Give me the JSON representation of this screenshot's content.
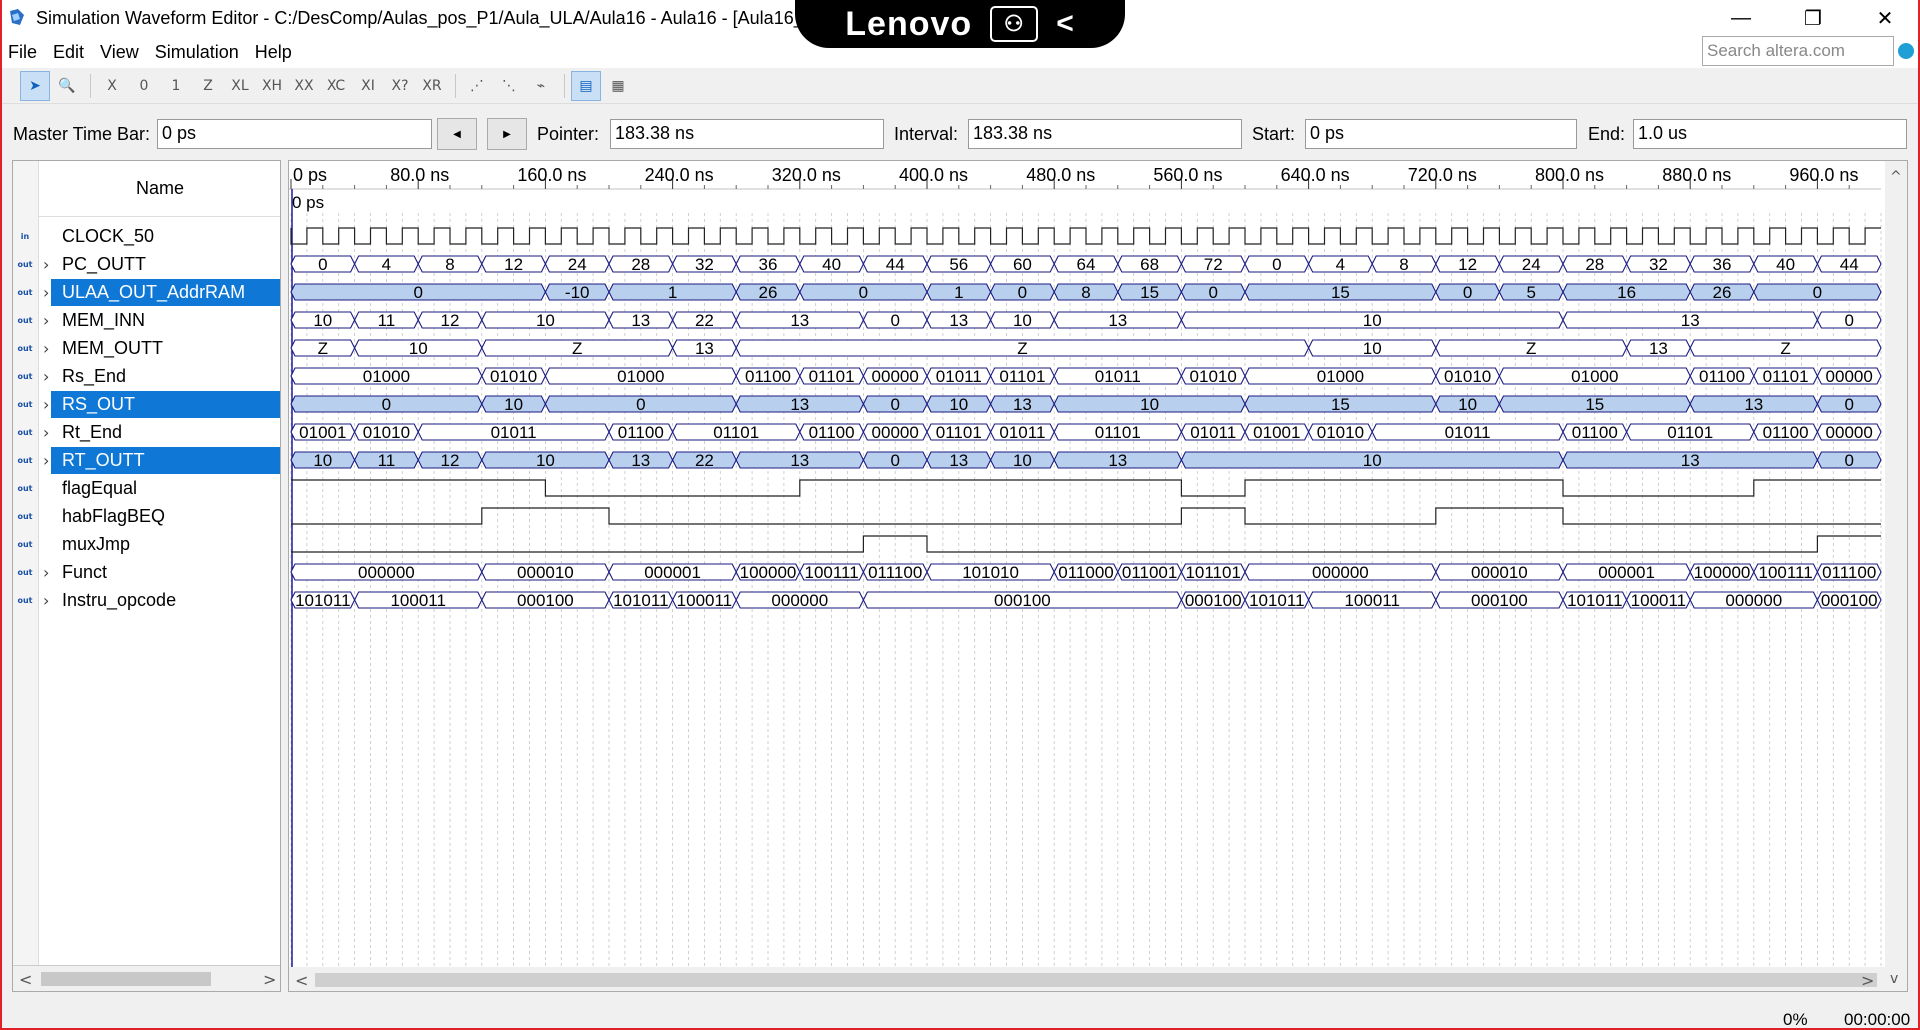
{
  "window": {
    "title": "Simulation Waveform Editor - C:/DesComp/Aulas_pos_P1/Aula_ULA/Aula16 - Aula16 - [Aula16_2",
    "minimize_glyph": "—",
    "restore_glyph": "❐",
    "close_glyph": "✕"
  },
  "overlay": {
    "brand": "Lenovo",
    "box_glyph": "⚇",
    "back_glyph": "<"
  },
  "menu": {
    "items": [
      "File",
      "Edit",
      "View",
      "Simulation",
      "Help"
    ]
  },
  "search": {
    "placeholder": "Search altera.com"
  },
  "toolbar": {
    "tools": [
      {
        "icon": "pointer-icon",
        "glyph": "➤",
        "active": true
      },
      {
        "icon": "zoom-icon",
        "glyph": "🔍",
        "active": false
      },
      {
        "icon": "sep"
      },
      {
        "icon": "force-unknown-icon",
        "glyph": "X"
      },
      {
        "icon": "force-low-icon",
        "glyph": "0"
      },
      {
        "icon": "force-high-icon",
        "glyph": "1"
      },
      {
        "icon": "high-impedance-icon",
        "glyph": "Z"
      },
      {
        "icon": "weak-low-icon",
        "glyph": "XL"
      },
      {
        "icon": "weak-high-icon",
        "glyph": "XH"
      },
      {
        "icon": "dont-care-icon",
        "glyph": "XX"
      },
      {
        "icon": "invert-icon",
        "glyph": "XC"
      },
      {
        "icon": "count-value-icon",
        "glyph": "XI"
      },
      {
        "icon": "arbitrary-value-icon",
        "glyph": "X?"
      },
      {
        "icon": "random-value-icon",
        "glyph": "XR"
      },
      {
        "icon": "sep"
      },
      {
        "icon": "snap-grid-icon",
        "glyph": "⋰"
      },
      {
        "icon": "grid-icon",
        "glyph": "⋱"
      },
      {
        "icon": "overwrite-icon",
        "glyph": "⌁"
      },
      {
        "icon": "sep"
      },
      {
        "icon": "waveform-view-icon",
        "glyph": "▤",
        "active": true
      },
      {
        "icon": "grid-view-icon",
        "glyph": "▦"
      }
    ]
  },
  "timebar": {
    "master_label": "Master Time Bar:",
    "master_value": "0 ps",
    "prev_glyph": "◀",
    "next_glyph": "▶",
    "pointer_label": "Pointer:",
    "pointer_value": "183.38 ns",
    "interval_label": "Interval:",
    "interval_value": "183.38 ns",
    "start_label": "Start:",
    "start_value": "0 ps",
    "end_label": "End:",
    "end_value": "1.0 us"
  },
  "names_header": "Name",
  "time_scale": {
    "ticks": [
      "0 ps",
      "80.0 ns",
      "160.0 ns",
      "240.0 ns",
      "320.0 ns",
      "400.0 ns",
      "480.0 ns",
      "560.0 ns",
      "640.0 ns",
      "720.0 ns",
      "800.0 ns",
      "880.0 ns",
      "960.0 ns"
    ],
    "marker_label": "0 ps"
  },
  "signals": [
    {
      "name": "CLOCK_50",
      "dir": "in",
      "kind": "clock",
      "expand": false,
      "selected": false
    },
    {
      "name": "PC_OUTT",
      "dir": "out",
      "kind": "bus",
      "expand": true,
      "selected": false,
      "segments": [
        [
          0,
          "0"
        ],
        [
          40,
          "4"
        ],
        [
          80,
          "8"
        ],
        [
          120,
          "12"
        ],
        [
          160,
          "24"
        ],
        [
          200,
          "28"
        ],
        [
          240,
          "32"
        ],
        [
          280,
          "36"
        ],
        [
          320,
          "40"
        ],
        [
          360,
          "44"
        ],
        [
          400,
          "56"
        ],
        [
          440,
          "60"
        ],
        [
          480,
          "64"
        ],
        [
          520,
          "68"
        ],
        [
          560,
          "72"
        ],
        [
          600,
          "0"
        ],
        [
          640,
          "4"
        ],
        [
          680,
          "8"
        ],
        [
          720,
          "12"
        ],
        [
          760,
          "24"
        ],
        [
          800,
          "28"
        ],
        [
          840,
          "32"
        ],
        [
          880,
          "36"
        ],
        [
          920,
          "40"
        ],
        [
          960,
          "44"
        ]
      ]
    },
    {
      "name": "ULAA_OUT_AddrRAM",
      "dir": "out",
      "kind": "bus",
      "expand": true,
      "selected": true,
      "segments": [
        [
          0,
          "0"
        ],
        [
          160,
          "-10"
        ],
        [
          200,
          "1"
        ],
        [
          280,
          "26"
        ],
        [
          320,
          "0"
        ],
        [
          400,
          "1"
        ],
        [
          440,
          "0"
        ],
        [
          480,
          "8"
        ],
        [
          520,
          "15"
        ],
        [
          560,
          "0"
        ],
        [
          600,
          "15"
        ],
        [
          720,
          "0"
        ],
        [
          760,
          "5"
        ],
        [
          800,
          "16"
        ],
        [
          880,
          "26"
        ],
        [
          920,
          "0"
        ]
      ]
    },
    {
      "name": "MEM_INN",
      "dir": "out",
      "kind": "bus",
      "expand": true,
      "selected": false,
      "segments": [
        [
          0,
          "10"
        ],
        [
          40,
          "11"
        ],
        [
          80,
          "12"
        ],
        [
          120,
          "10"
        ],
        [
          200,
          "13"
        ],
        [
          240,
          "22"
        ],
        [
          280,
          "13"
        ],
        [
          360,
          "0"
        ],
        [
          400,
          "13"
        ],
        [
          440,
          "10"
        ],
        [
          480,
          "13"
        ],
        [
          560,
          "10"
        ],
        [
          800,
          "13"
        ],
        [
          960,
          "0"
        ]
      ]
    },
    {
      "name": "MEM_OUTT",
      "dir": "out",
      "kind": "bus",
      "expand": true,
      "selected": false,
      "segments": [
        [
          0,
          "Z"
        ],
        [
          40,
          "10"
        ],
        [
          120,
          "Z"
        ],
        [
          240,
          "13"
        ],
        [
          280,
          "Z"
        ],
        [
          640,
          "10"
        ],
        [
          720,
          "Z"
        ],
        [
          840,
          "13"
        ],
        [
          880,
          "Z"
        ]
      ]
    },
    {
      "name": "Rs_End",
      "dir": "out",
      "kind": "bus",
      "expand": true,
      "selected": false,
      "segments": [
        [
          0,
          "01000"
        ],
        [
          120,
          "01010"
        ],
        [
          160,
          "01000"
        ],
        [
          280,
          "01100"
        ],
        [
          320,
          "01101"
        ],
        [
          360,
          "00000"
        ],
        [
          400,
          "01011"
        ],
        [
          440,
          "01101"
        ],
        [
          480,
          "01011"
        ],
        [
          560,
          "01010"
        ],
        [
          600,
          "01000"
        ],
        [
          720,
          "01010"
        ],
        [
          760,
          "01000"
        ],
        [
          880,
          "01100"
        ],
        [
          920,
          "01101"
        ],
        [
          960,
          "00000"
        ]
      ]
    },
    {
      "name": "RS_OUT",
      "dir": "out",
      "kind": "bus",
      "expand": true,
      "selected": true,
      "segments": [
        [
          0,
          "0"
        ],
        [
          120,
          "10"
        ],
        [
          160,
          "0"
        ],
        [
          280,
          "13"
        ],
        [
          360,
          "0"
        ],
        [
          400,
          "10"
        ],
        [
          440,
          "13"
        ],
        [
          480,
          "10"
        ],
        [
          600,
          "15"
        ],
        [
          720,
          "10"
        ],
        [
          760,
          "15"
        ],
        [
          880,
          "13"
        ],
        [
          960,
          "0"
        ]
      ]
    },
    {
      "name": "Rt_End",
      "dir": "out",
      "kind": "bus",
      "expand": true,
      "selected": false,
      "segments": [
        [
          0,
          "01001"
        ],
        [
          40,
          "01010"
        ],
        [
          80,
          "01011"
        ],
        [
          200,
          "01100"
        ],
        [
          240,
          "01101"
        ],
        [
          320,
          "01100"
        ],
        [
          360,
          "00000"
        ],
        [
          400,
          "01101"
        ],
        [
          440,
          "01011"
        ],
        [
          480,
          "01101"
        ],
        [
          560,
          "01011"
        ],
        [
          600,
          "01001"
        ],
        [
          640,
          "01010"
        ],
        [
          680,
          "01011"
        ],
        [
          800,
          "01100"
        ],
        [
          840,
          "01101"
        ],
        [
          920,
          "01100"
        ],
        [
          960,
          "00000"
        ]
      ]
    },
    {
      "name": "RT_OUTT",
      "dir": "out",
      "kind": "bus",
      "expand": true,
      "selected": true,
      "segments": [
        [
          0,
          "10"
        ],
        [
          40,
          "11"
        ],
        [
          80,
          "12"
        ],
        [
          120,
          "10"
        ],
        [
          200,
          "13"
        ],
        [
          240,
          "22"
        ],
        [
          280,
          "13"
        ],
        [
          360,
          "0"
        ],
        [
          400,
          "13"
        ],
        [
          440,
          "10"
        ],
        [
          480,
          "13"
        ],
        [
          560,
          "10"
        ],
        [
          800,
          "13"
        ],
        [
          960,
          "0"
        ]
      ]
    },
    {
      "name": "flagEqual",
      "dir": "out",
      "kind": "bit",
      "expand": false,
      "selected": false,
      "levels": [
        [
          0,
          1
        ],
        [
          160,
          0
        ],
        [
          320,
          1
        ],
        [
          560,
          0
        ],
        [
          600,
          1
        ],
        [
          800,
          0
        ],
        [
          920,
          1
        ]
      ]
    },
    {
      "name": "habFlagBEQ",
      "dir": "out",
      "kind": "bit",
      "expand": false,
      "selected": false,
      "levels": [
        [
          0,
          0
        ],
        [
          120,
          1
        ],
        [
          200,
          0
        ],
        [
          560,
          1
        ],
        [
          600,
          0
        ],
        [
          720,
          1
        ],
        [
          800,
          0
        ]
      ]
    },
    {
      "name": "muxJmp",
      "dir": "out",
      "kind": "bit",
      "expand": false,
      "selected": false,
      "levels": [
        [
          0,
          0
        ],
        [
          360,
          1
        ],
        [
          400,
          0
        ],
        [
          960,
          1
        ]
      ]
    },
    {
      "name": "Funct",
      "dir": "out",
      "kind": "bus",
      "expand": true,
      "selected": false,
      "segments": [
        [
          0,
          "000000"
        ],
        [
          120,
          "000010"
        ],
        [
          200,
          "000001"
        ],
        [
          280,
          "100000"
        ],
        [
          320,
          "100111"
        ],
        [
          360,
          "011100"
        ],
        [
          400,
          "101010"
        ],
        [
          480,
          "011000"
        ],
        [
          520,
          "011001"
        ],
        [
          560,
          "101101"
        ],
        [
          600,
          "000000"
        ],
        [
          720,
          "000010"
        ],
        [
          800,
          "000001"
        ],
        [
          880,
          "100000"
        ],
        [
          920,
          "100111"
        ],
        [
          960,
          "011100"
        ]
      ]
    },
    {
      "name": "Instru_opcode",
      "dir": "out",
      "kind": "bus",
      "expand": true,
      "selected": false,
      "segments": [
        [
          0,
          "101011"
        ],
        [
          40,
          "100011"
        ],
        [
          120,
          "000100"
        ],
        [
          200,
          "101011"
        ],
        [
          240,
          "100011"
        ],
        [
          280,
          "000000"
        ],
        [
          360,
          "000100"
        ],
        [
          560,
          "000100"
        ],
        [
          600,
          "101011"
        ],
        [
          640,
          "100011"
        ],
        [
          720,
          "000100"
        ],
        [
          800,
          "101011"
        ],
        [
          840,
          "100011"
        ],
        [
          880,
          "000000"
        ],
        [
          960,
          "000100"
        ]
      ]
    }
  ],
  "status": {
    "progress": "0%",
    "elapsed": "00:00:00"
  },
  "colors": {
    "selected": "#0f78d7",
    "bus_selected_fill": "#b8d0ee",
    "wave_line": "#1a1a80",
    "grid": "#c4c4c4"
  }
}
